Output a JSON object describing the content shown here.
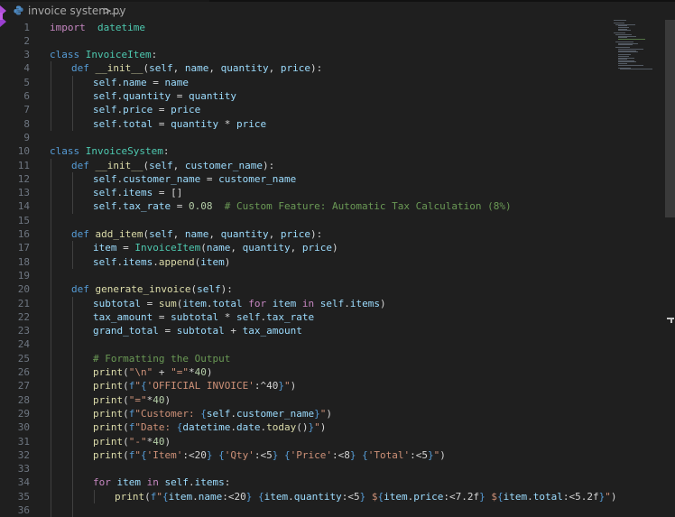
{
  "breadcrumb": {
    "file_name": "invoice system.py",
    "separator": ">",
    "ellipsis": "..."
  },
  "colors": {
    "background": "#1f1f1f",
    "keyword": "#c586c0",
    "def_keyword": "#569cd6",
    "class_name": "#4ec9b0",
    "function": "#dcdcaa",
    "variable": "#9cdcfe",
    "string": "#ce9178",
    "number": "#b5cea8",
    "comment": "#6a9955",
    "line_number": "#6e7681"
  },
  "icons": {
    "file_type": "python-file-icon",
    "logo": "visual-studio-logo-icon"
  },
  "editor": {
    "lines": [
      {
        "n": "1",
        "tokens": [
          [
            "kw",
            "import"
          ],
          [
            "",
            "  "
          ],
          [
            "cls",
            "datetime"
          ]
        ]
      },
      {
        "n": "2",
        "tokens": []
      },
      {
        "n": "3",
        "tokens": [
          [
            "kwb",
            "class"
          ],
          [
            "",
            " "
          ],
          [
            "cls",
            "InvoiceItem"
          ],
          [
            "",
            ":"
          ]
        ]
      },
      {
        "n": "4",
        "tokens": [
          [
            "",
            " "
          ],
          [
            "kwb",
            "def"
          ],
          [
            "",
            " "
          ],
          [
            "fn",
            "__init__"
          ],
          [
            "",
            "("
          ],
          [
            "var",
            "self"
          ],
          [
            "",
            ", "
          ],
          [
            "var",
            "name"
          ],
          [
            "",
            ", "
          ],
          [
            "var",
            "quantity"
          ],
          [
            "",
            ", "
          ],
          [
            "var",
            "price"
          ],
          [
            "",
            "):"
          ]
        ]
      },
      {
        "n": "5",
        "tokens": [
          [
            "var",
            "self"
          ],
          [
            "",
            "."
          ],
          [
            "var",
            "name"
          ],
          [
            "",
            " = "
          ],
          [
            "var",
            "name"
          ]
        ]
      },
      {
        "n": "6",
        "tokens": [
          [
            "var",
            "self"
          ],
          [
            "",
            "."
          ],
          [
            "var",
            "quantity"
          ],
          [
            "",
            " = "
          ],
          [
            "var",
            "quantity"
          ]
        ]
      },
      {
        "n": "7",
        "tokens": [
          [
            "var",
            "self"
          ],
          [
            "",
            "."
          ],
          [
            "var",
            "price"
          ],
          [
            "",
            " = "
          ],
          [
            "var",
            "price"
          ]
        ]
      },
      {
        "n": "8",
        "tokens": [
          [
            "var",
            "self"
          ],
          [
            "",
            "."
          ],
          [
            "var",
            "total"
          ],
          [
            "",
            " = "
          ],
          [
            "var",
            "quantity"
          ],
          [
            "",
            " * "
          ],
          [
            "var",
            "price"
          ]
        ]
      },
      {
        "n": "9",
        "tokens": []
      },
      {
        "n": "10",
        "tokens": [
          [
            "kwb",
            "class"
          ],
          [
            "",
            " "
          ],
          [
            "cls",
            "InvoiceSystem"
          ],
          [
            "",
            ":"
          ]
        ]
      },
      {
        "n": "11",
        "tokens": [
          [
            "",
            " "
          ],
          [
            "kwb",
            "def"
          ],
          [
            "",
            " "
          ],
          [
            "fn",
            "__init__"
          ],
          [
            "",
            "("
          ],
          [
            "var",
            "self"
          ],
          [
            "",
            ", "
          ],
          [
            "var",
            "customer_name"
          ],
          [
            "",
            "):"
          ]
        ]
      },
      {
        "n": "12",
        "tokens": [
          [
            "var",
            "self"
          ],
          [
            "",
            "."
          ],
          [
            "var",
            "customer_name"
          ],
          [
            "",
            " = "
          ],
          [
            "var",
            "customer_name"
          ]
        ]
      },
      {
        "n": "13",
        "tokens": [
          [
            "var",
            "self"
          ],
          [
            "",
            "."
          ],
          [
            "var",
            "items"
          ],
          [
            "",
            " = []"
          ]
        ]
      },
      {
        "n": "14",
        "tokens": [
          [
            "var",
            "self"
          ],
          [
            "",
            "."
          ],
          [
            "var",
            "tax_rate"
          ],
          [
            "",
            " = "
          ],
          [
            "num",
            "0.08"
          ],
          [
            "",
            "  "
          ],
          [
            "com",
            "# Custom Feature: Automatic Tax Calculation (8%)"
          ]
        ]
      },
      {
        "n": "15",
        "tokens": []
      },
      {
        "n": "16",
        "tokens": [
          [
            "",
            " "
          ],
          [
            "kwb",
            "def"
          ],
          [
            "",
            " "
          ],
          [
            "fn",
            "add_item"
          ],
          [
            "",
            "("
          ],
          [
            "var",
            "self"
          ],
          [
            "",
            ", "
          ],
          [
            "var",
            "name"
          ],
          [
            "",
            ", "
          ],
          [
            "var",
            "quantity"
          ],
          [
            "",
            ", "
          ],
          [
            "var",
            "price"
          ],
          [
            "",
            "):"
          ]
        ]
      },
      {
        "n": "17",
        "tokens": [
          [
            "var",
            "item"
          ],
          [
            "",
            " = "
          ],
          [
            "cls",
            "InvoiceItem"
          ],
          [
            "",
            "("
          ],
          [
            "var",
            "name"
          ],
          [
            "",
            ", "
          ],
          [
            "var",
            "quantity"
          ],
          [
            "",
            ", "
          ],
          [
            "var",
            "price"
          ],
          [
            "",
            ")"
          ]
        ]
      },
      {
        "n": "18",
        "tokens": [
          [
            "var",
            "self"
          ],
          [
            "",
            "."
          ],
          [
            "var",
            "items"
          ],
          [
            "",
            "."
          ],
          [
            "fn",
            "append"
          ],
          [
            "",
            "("
          ],
          [
            "var",
            "item"
          ],
          [
            "",
            ")"
          ]
        ]
      },
      {
        "n": "19",
        "tokens": []
      },
      {
        "n": "20",
        "tokens": [
          [
            "",
            " "
          ],
          [
            "kwb",
            "def"
          ],
          [
            "",
            " "
          ],
          [
            "fn",
            "generate_invoice"
          ],
          [
            "",
            "("
          ],
          [
            "var",
            "self"
          ],
          [
            "",
            "):"
          ]
        ]
      },
      {
        "n": "21",
        "tokens": [
          [
            "var",
            "subtotal"
          ],
          [
            "",
            " = "
          ],
          [
            "fn",
            "sum"
          ],
          [
            "",
            "("
          ],
          [
            "var",
            "item"
          ],
          [
            "",
            "."
          ],
          [
            "var",
            "total"
          ],
          [
            "",
            " "
          ],
          [
            "kw",
            "for"
          ],
          [
            "",
            " "
          ],
          [
            "var",
            "item"
          ],
          [
            "",
            " "
          ],
          [
            "kw",
            "in"
          ],
          [
            "",
            " "
          ],
          [
            "var",
            "self"
          ],
          [
            "",
            "."
          ],
          [
            "var",
            "items"
          ],
          [
            "",
            ")"
          ]
        ]
      },
      {
        "n": "22",
        "tokens": [
          [
            "var",
            "tax_amount"
          ],
          [
            "",
            " = "
          ],
          [
            "var",
            "subtotal"
          ],
          [
            "",
            " * "
          ],
          [
            "var",
            "self"
          ],
          [
            "",
            "."
          ],
          [
            "var",
            "tax_rate"
          ]
        ]
      },
      {
        "n": "23",
        "tokens": [
          [
            "var",
            "grand_total"
          ],
          [
            "",
            " = "
          ],
          [
            "var",
            "subtotal"
          ],
          [
            "",
            " + "
          ],
          [
            "var",
            "tax_amount"
          ]
        ]
      },
      {
        "n": "24",
        "tokens": []
      },
      {
        "n": "25",
        "tokens": [
          [
            "com",
            "# Formatting the Output"
          ]
        ]
      },
      {
        "n": "26",
        "tokens": [
          [
            "fn",
            "print"
          ],
          [
            "",
            "("
          ],
          [
            "str",
            "\"\\n\""
          ],
          [
            "",
            " + "
          ],
          [
            "str",
            "\"=\""
          ],
          [
            "",
            "*"
          ],
          [
            "num",
            "40"
          ],
          [
            "",
            ")"
          ]
        ]
      },
      {
        "n": "27",
        "tokens": [
          [
            "fn",
            "print"
          ],
          [
            "",
            "("
          ],
          [
            "kwb",
            "f"
          ],
          [
            "str",
            "\""
          ],
          [
            "brace",
            "{"
          ],
          [
            "str",
            "'OFFICIAL INVOICE'"
          ],
          [
            "",
            ":^40"
          ],
          [
            "brace",
            "}"
          ],
          [
            "str",
            "\""
          ],
          [
            "",
            ")"
          ]
        ]
      },
      {
        "n": "28",
        "tokens": [
          [
            "fn",
            "print"
          ],
          [
            "",
            "("
          ],
          [
            "str",
            "\"=\""
          ],
          [
            "",
            "*"
          ],
          [
            "num",
            "40"
          ],
          [
            "",
            ")"
          ]
        ]
      },
      {
        "n": "29",
        "tokens": [
          [
            "fn",
            "print"
          ],
          [
            "",
            "("
          ],
          [
            "kwb",
            "f"
          ],
          [
            "str",
            "\"Customer: "
          ],
          [
            "brace",
            "{"
          ],
          [
            "var",
            "self"
          ],
          [
            "",
            "."
          ],
          [
            "var",
            "customer_name"
          ],
          [
            "brace",
            "}"
          ],
          [
            "str",
            "\""
          ],
          [
            "",
            ")"
          ]
        ]
      },
      {
        "n": "30",
        "tokens": [
          [
            "fn",
            "print"
          ],
          [
            "",
            "("
          ],
          [
            "kwb",
            "f"
          ],
          [
            "str",
            "\"Date: "
          ],
          [
            "brace",
            "{"
          ],
          [
            "var",
            "datetime"
          ],
          [
            "",
            "."
          ],
          [
            "var",
            "date"
          ],
          [
            "",
            "."
          ],
          [
            "fn",
            "today"
          ],
          [
            "",
            "()"
          ],
          [
            "brace",
            "}"
          ],
          [
            "str",
            "\""
          ],
          [
            "",
            ")"
          ]
        ]
      },
      {
        "n": "31",
        "tokens": [
          [
            "fn",
            "print"
          ],
          [
            "",
            "("
          ],
          [
            "str",
            "\"-\""
          ],
          [
            "",
            "*"
          ],
          [
            "num",
            "40"
          ],
          [
            "",
            ")"
          ]
        ]
      },
      {
        "n": "32",
        "tokens": [
          [
            "fn",
            "print"
          ],
          [
            "",
            "("
          ],
          [
            "kwb",
            "f"
          ],
          [
            "str",
            "\""
          ],
          [
            "brace",
            "{"
          ],
          [
            "str",
            "'Item'"
          ],
          [
            "",
            ":<20"
          ],
          [
            "brace",
            "}"
          ],
          [
            "str",
            " "
          ],
          [
            "brace",
            "{"
          ],
          [
            "str",
            "'Qty'"
          ],
          [
            "",
            ":<5"
          ],
          [
            "brace",
            "}"
          ],
          [
            "str",
            " "
          ],
          [
            "brace",
            "{"
          ],
          [
            "str",
            "'Price'"
          ],
          [
            "",
            ":<8"
          ],
          [
            "brace",
            "}"
          ],
          [
            "str",
            " "
          ],
          [
            "brace",
            "{"
          ],
          [
            "str",
            "'Total'"
          ],
          [
            "",
            ":<5"
          ],
          [
            "brace",
            "}"
          ],
          [
            "str",
            "\""
          ],
          [
            "",
            ")"
          ]
        ]
      },
      {
        "n": "33",
        "tokens": []
      },
      {
        "n": "34",
        "tokens": [
          [
            "kw",
            "for"
          ],
          [
            "",
            " "
          ],
          [
            "var",
            "item"
          ],
          [
            "",
            " "
          ],
          [
            "kw",
            "in"
          ],
          [
            "",
            " "
          ],
          [
            "var",
            "self"
          ],
          [
            "",
            "."
          ],
          [
            "var",
            "items"
          ],
          [
            "",
            ":"
          ]
        ]
      },
      {
        "n": "35",
        "tokens": [
          [
            "fn",
            "print"
          ],
          [
            "",
            "("
          ],
          [
            "kwb",
            "f"
          ],
          [
            "str",
            "\""
          ],
          [
            "brace",
            "{"
          ],
          [
            "var",
            "item"
          ],
          [
            "",
            "."
          ],
          [
            "var",
            "name"
          ],
          [
            "",
            ":<20"
          ],
          [
            "brace",
            "}"
          ],
          [
            "str",
            " "
          ],
          [
            "brace",
            "{"
          ],
          [
            "var",
            "item"
          ],
          [
            "",
            "."
          ],
          [
            "var",
            "quantity"
          ],
          [
            "",
            ":<5"
          ],
          [
            "brace",
            "}"
          ],
          [
            "str",
            " $"
          ],
          [
            "brace",
            "{"
          ],
          [
            "var",
            "item"
          ],
          [
            "",
            "."
          ],
          [
            "var",
            "price"
          ],
          [
            "",
            ":<7.2f"
          ],
          [
            "brace",
            "}"
          ],
          [
            "str",
            " $"
          ],
          [
            "brace",
            "{"
          ],
          [
            "var",
            "item"
          ],
          [
            "",
            "."
          ],
          [
            "var",
            "total"
          ],
          [
            "",
            ":<5.2f"
          ],
          [
            "brace",
            "}"
          ],
          [
            "str",
            "\""
          ],
          [
            "",
            ")"
          ]
        ]
      },
      {
        "n": "36",
        "tokens": []
      }
    ]
  }
}
